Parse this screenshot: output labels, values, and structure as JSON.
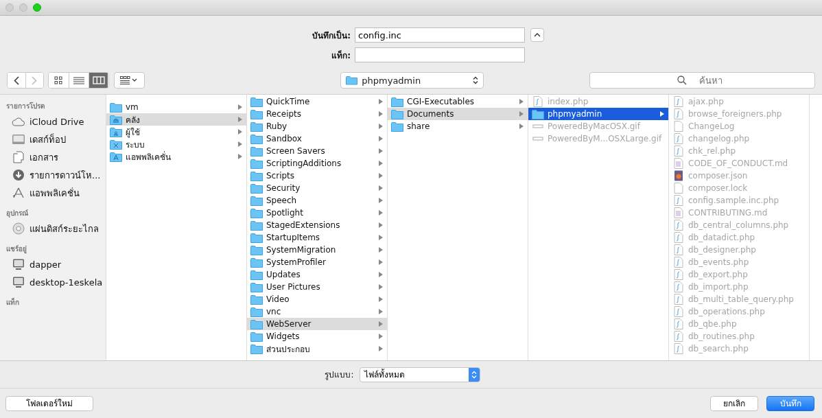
{
  "save_as": {
    "label": "บันทึกเป็น:",
    "value": "config.inc"
  },
  "tags": {
    "label": "แท็ก:"
  },
  "toolbar": {
    "view_modes": [
      {
        "kind": "icon",
        "selected": false
      },
      {
        "kind": "list",
        "selected": false
      },
      {
        "kind": "column",
        "selected": true
      }
    ],
    "location": "phpmyadmin",
    "search": {
      "placeholder": "ค้นหา"
    }
  },
  "sidebar": {
    "sections": [
      {
        "title": "รายการโปรด",
        "items": [
          {
            "label": "iCloud Drive",
            "kind": "cloud"
          },
          {
            "label": "เดสก์ท็อป",
            "kind": "desktop"
          },
          {
            "label": "เอกสาร",
            "kind": "documents"
          },
          {
            "label": "รายการดาวน์โห...",
            "kind": "downloads"
          },
          {
            "label": "แอพพลิเคชั่น",
            "kind": "apps"
          }
        ]
      },
      {
        "title": "อุปกรณ์",
        "items": [
          {
            "label": "แผ่นดิสก์ระยะไกล",
            "kind": "disc"
          }
        ]
      },
      {
        "title": "แชร์อยู่",
        "items": [
          {
            "label": "dapper",
            "kind": "computer"
          },
          {
            "label": "desktop-1eskela",
            "kind": "computer"
          }
        ]
      },
      {
        "title": "แท็ก"
      }
    ]
  },
  "columns": [
    {
      "active": false,
      "items": [
        {
          "name": "vm",
          "kind": "folder",
          "selected": false,
          "disabled": false
        },
        {
          "name": "คลัง",
          "kind": "library",
          "selected": true,
          "disabled": false
        },
        {
          "name": "ผู้ใช้",
          "kind": "users",
          "selected": false,
          "disabled": false
        },
        {
          "name": "ระบบ",
          "kind": "system",
          "selected": false,
          "disabled": false
        },
        {
          "name": "แอพพลิเคชั่น",
          "kind": "apps",
          "selected": false,
          "disabled": false
        }
      ]
    },
    {
      "active": false,
      "items": [
        {
          "name": "QuickTime",
          "kind": "folder",
          "selected": false,
          "disabled": false
        },
        {
          "name": "Receipts",
          "kind": "folder",
          "selected": false,
          "disabled": false
        },
        {
          "name": "Ruby",
          "kind": "folder",
          "selected": false,
          "disabled": false
        },
        {
          "name": "Sandbox",
          "kind": "folder",
          "selected": false,
          "disabled": false
        },
        {
          "name": "Screen Savers",
          "kind": "folder",
          "selected": false,
          "disabled": false
        },
        {
          "name": "ScriptingAdditions",
          "kind": "folder",
          "selected": false,
          "disabled": false
        },
        {
          "name": "Scripts",
          "kind": "folder",
          "selected": false,
          "disabled": false
        },
        {
          "name": "Security",
          "kind": "folder",
          "selected": false,
          "disabled": false
        },
        {
          "name": "Speech",
          "kind": "folder",
          "selected": false,
          "disabled": false
        },
        {
          "name": "Spotlight",
          "kind": "folder",
          "selected": false,
          "disabled": false
        },
        {
          "name": "StagedExtensions",
          "kind": "folder",
          "selected": false,
          "disabled": false
        },
        {
          "name": "StartupItems",
          "kind": "folder",
          "selected": false,
          "disabled": false
        },
        {
          "name": "SystemMigration",
          "kind": "folder",
          "selected": false,
          "disabled": false
        },
        {
          "name": "SystemProfiler",
          "kind": "folder",
          "selected": false,
          "disabled": false
        },
        {
          "name": "Updates",
          "kind": "folder",
          "selected": false,
          "disabled": false
        },
        {
          "name": "User Pictures",
          "kind": "folder",
          "selected": false,
          "disabled": false
        },
        {
          "name": "Video",
          "kind": "folder",
          "selected": false,
          "disabled": false
        },
        {
          "name": "vnc",
          "kind": "folder",
          "selected": false,
          "disabled": false
        },
        {
          "name": "WebServer",
          "kind": "folder",
          "selected": true,
          "disabled": false
        },
        {
          "name": "Widgets",
          "kind": "folder",
          "selected": false,
          "disabled": false
        },
        {
          "name": "ส่วนประกอบ",
          "kind": "folder",
          "selected": false,
          "disabled": false
        }
      ]
    },
    {
      "active": false,
      "items": [
        {
          "name": "CGI-Executables",
          "kind": "folder",
          "selected": false,
          "disabled": false
        },
        {
          "name": "Documents",
          "kind": "folder",
          "selected": true,
          "disabled": false
        },
        {
          "name": "share",
          "kind": "folder",
          "selected": false,
          "disabled": false
        }
      ]
    },
    {
      "active": true,
      "items": [
        {
          "name": "index.php",
          "kind": "php",
          "selected": false,
          "disabled": true
        },
        {
          "name": "phpmyadmin",
          "kind": "folder",
          "selected": true,
          "disabled": false
        },
        {
          "name": "PoweredByMacOSX.gif",
          "kind": "image",
          "selected": false,
          "disabled": true
        },
        {
          "name": "PoweredByM...OSXLarge.gif",
          "kind": "image",
          "selected": false,
          "disabled": true
        }
      ]
    },
    {
      "items": [
        {
          "name": "ajax.php",
          "kind": "php",
          "selected": false,
          "disabled": true
        },
        {
          "name": "browse_foreigners.php",
          "kind": "php",
          "selected": false,
          "disabled": true
        },
        {
          "name": "ChangeLog",
          "kind": "plain",
          "selected": false,
          "disabled": true
        },
        {
          "name": "changelog.php",
          "kind": "php",
          "selected": false,
          "disabled": true
        },
        {
          "name": "chk_rel.php",
          "kind": "php",
          "selected": false,
          "disabled": true
        },
        {
          "name": "CODE_OF_CONDUCT.md",
          "kind": "text",
          "selected": false,
          "disabled": true
        },
        {
          "name": "composer.json",
          "kind": "json",
          "selected": false,
          "disabled": true
        },
        {
          "name": "composer.lock",
          "kind": "plain",
          "selected": false,
          "disabled": true
        },
        {
          "name": "config.sample.inc.php",
          "kind": "php",
          "selected": false,
          "disabled": true
        },
        {
          "name": "CONTRIBUTING.md",
          "kind": "text",
          "selected": false,
          "disabled": true
        },
        {
          "name": "db_central_columns.php",
          "kind": "php",
          "selected": false,
          "disabled": true
        },
        {
          "name": "db_datadict.php",
          "kind": "php",
          "selected": false,
          "disabled": true
        },
        {
          "name": "db_designer.php",
          "kind": "php",
          "selected": false,
          "disabled": true
        },
        {
          "name": "db_events.php",
          "kind": "php",
          "selected": false,
          "disabled": true
        },
        {
          "name": "db_export.php",
          "kind": "php",
          "selected": false,
          "disabled": true
        },
        {
          "name": "db_import.php",
          "kind": "php",
          "selected": false,
          "disabled": true
        },
        {
          "name": "db_multi_table_query.php",
          "kind": "php",
          "selected": false,
          "disabled": true
        },
        {
          "name": "db_operations.php",
          "kind": "php",
          "selected": false,
          "disabled": true
        },
        {
          "name": "db_qbe.php",
          "kind": "php",
          "selected": false,
          "disabled": true
        },
        {
          "name": "db_routines.php",
          "kind": "php",
          "selected": false,
          "disabled": true
        },
        {
          "name": "db_search.php",
          "kind": "php",
          "selected": false,
          "disabled": true
        }
      ]
    }
  ],
  "format": {
    "label": "รูปแบบ:",
    "value": "ไฟล์ทั้งหมด"
  },
  "buttons": [
    {
      "label": "โฟลเดอร์ใหม่",
      "kind": "new_folder",
      "default": false
    },
    {
      "label": "ยกเลิก",
      "kind": "cancel",
      "default": false
    },
    {
      "label": "บันทึก",
      "kind": "save",
      "default": true
    }
  ]
}
